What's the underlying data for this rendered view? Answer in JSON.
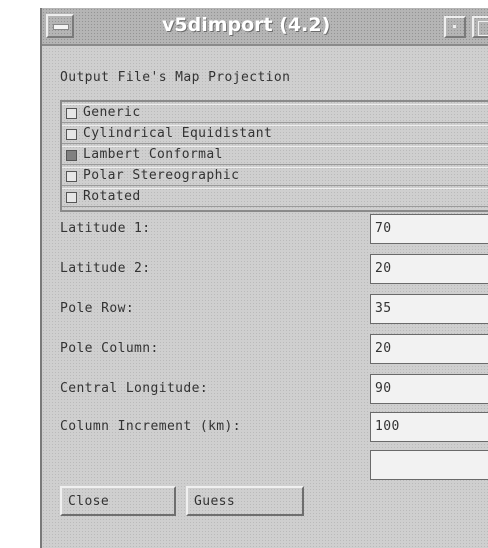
{
  "window": {
    "title": "v5dimport (4.2)"
  },
  "projection": {
    "label": "Output File's Map Projection",
    "options": [
      {
        "label": "Generic",
        "selected": false
      },
      {
        "label": "Cylindrical Equidistant",
        "selected": false
      },
      {
        "label": "Lambert Conformal",
        "selected": true
      },
      {
        "label": "Polar Stereographic",
        "selected": false
      },
      {
        "label": "Rotated",
        "selected": false
      }
    ]
  },
  "fields": [
    {
      "label": "Latitude 1:",
      "value": "70"
    },
    {
      "label": "Latitude 2:",
      "value": "20"
    },
    {
      "label": "Pole Row:",
      "value": "35"
    },
    {
      "label": "Pole Column:",
      "value": "20"
    },
    {
      "label": "Central Longitude:",
      "value": "90"
    },
    {
      "label": "Column Increment (km):",
      "value": "100"
    },
    {
      "label": "",
      "value": ""
    }
  ],
  "buttons": {
    "close": "Close",
    "guess": "Guess"
  },
  "icons": {
    "window_menu": "window-menu-icon",
    "minimize": "minimize-icon",
    "maximize": "maximize-icon"
  }
}
